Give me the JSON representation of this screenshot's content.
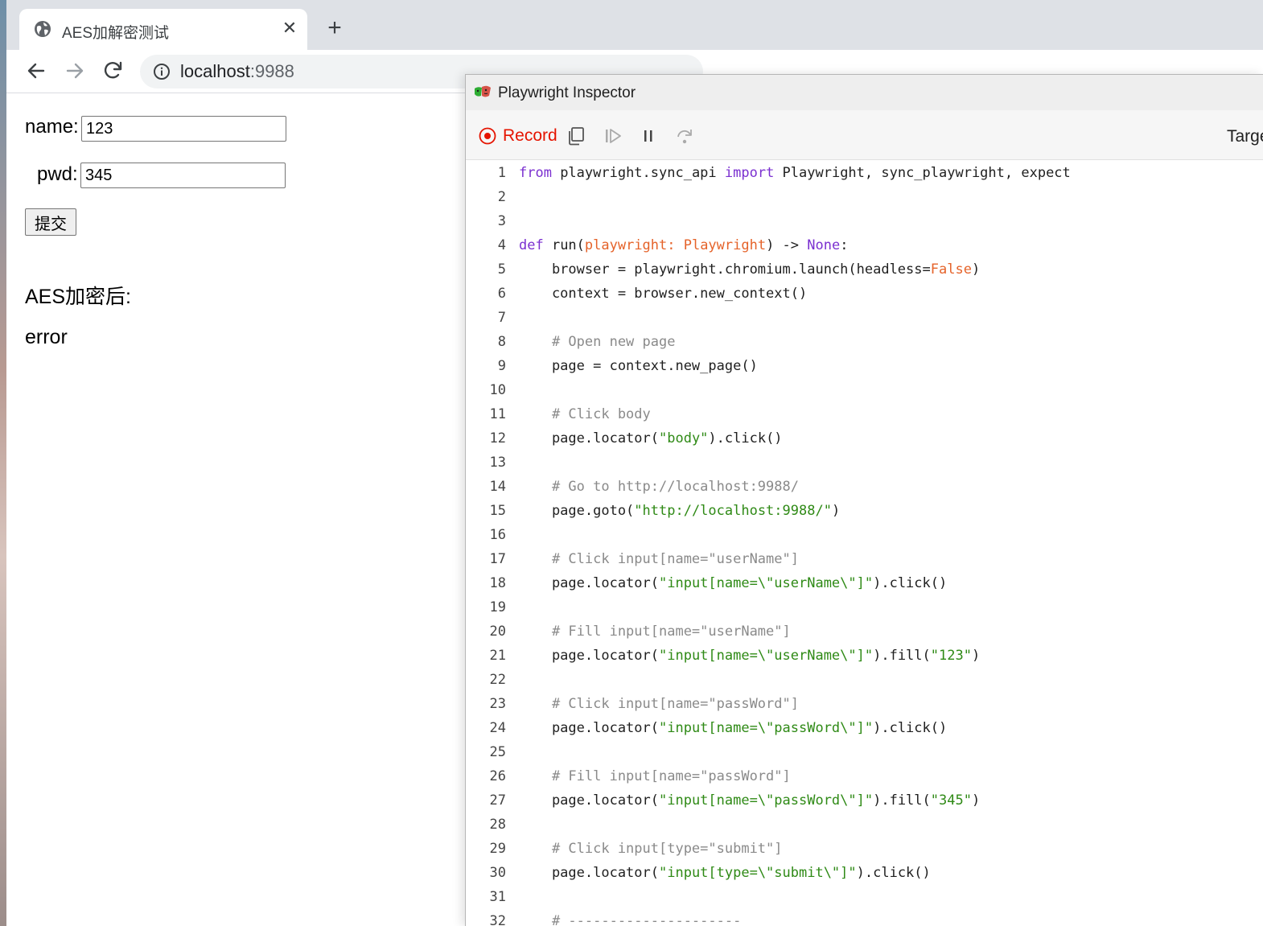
{
  "browser": {
    "tab": {
      "title": "AES加解密测试",
      "icon": "globe-icon",
      "close_icon": "close-icon"
    },
    "new_tab_icon": "plus-icon",
    "nav": {
      "back_icon": "arrow-left-icon",
      "forward_icon": "arrow-right-icon",
      "reload_icon": "reload-icon"
    },
    "address": {
      "host": "localhost",
      "port": ":9988",
      "info_icon": "info-icon"
    }
  },
  "page": {
    "name_label": "name:",
    "name_value": "123",
    "pwd_label": "pwd:",
    "pwd_value": "345",
    "submit_label": "提交",
    "result_label": "AES加密后:",
    "result_value": "error"
  },
  "inspector": {
    "title": "Playwright Inspector",
    "record_label": "Record",
    "target_label": "Target:",
    "icons": [
      "record-icon",
      "copy-icon",
      "resume-icon",
      "pause-icon",
      "step-over-icon"
    ],
    "code_lines": [
      [
        [
          "kw",
          "from"
        ],
        [
          "t",
          " playwright.sync_api "
        ],
        [
          "kw",
          "import"
        ],
        [
          "t",
          " Playwright, sync_playwright, expect"
        ]
      ],
      [],
      [],
      [
        [
          "kw",
          "def"
        ],
        [
          "t",
          " run("
        ],
        [
          "param",
          "playwright: Playwright"
        ],
        [
          "t",
          ") -> "
        ],
        [
          "none",
          "None"
        ],
        [
          "t",
          ":"
        ]
      ],
      [
        [
          "t",
          "    browser = playwright.chromium.launch(headless="
        ],
        [
          "const",
          "False"
        ],
        [
          "t",
          ")"
        ]
      ],
      [
        [
          "t",
          "    context = browser.new_context()"
        ]
      ],
      [],
      [
        [
          "cmt",
          "    # Open new page"
        ]
      ],
      [
        [
          "t",
          "    page = context.new_page()"
        ]
      ],
      [],
      [
        [
          "cmt",
          "    # Click body"
        ]
      ],
      [
        [
          "t",
          "    page.locator("
        ],
        [
          "str",
          "\"body\""
        ],
        [
          "t",
          ").click()"
        ]
      ],
      [],
      [
        [
          "cmt",
          "    # Go to http://localhost:9988/"
        ]
      ],
      [
        [
          "t",
          "    page.goto("
        ],
        [
          "str",
          "\"http://localhost:9988/\""
        ],
        [
          "t",
          ")"
        ]
      ],
      [],
      [
        [
          "cmt",
          "    # Click input[name=\"userName\"]"
        ]
      ],
      [
        [
          "t",
          "    page.locator("
        ],
        [
          "str",
          "\"input[name=\\\"userName\\\"]\""
        ],
        [
          "t",
          ").click()"
        ]
      ],
      [],
      [
        [
          "cmt",
          "    # Fill input[name=\"userName\"]"
        ]
      ],
      [
        [
          "t",
          "    page.locator("
        ],
        [
          "str",
          "\"input[name=\\\"userName\\\"]\""
        ],
        [
          "t",
          ").fill("
        ],
        [
          "str",
          "\"123\""
        ],
        [
          "t",
          ")"
        ]
      ],
      [],
      [
        [
          "cmt",
          "    # Click input[name=\"passWord\"]"
        ]
      ],
      [
        [
          "t",
          "    page.locator("
        ],
        [
          "str",
          "\"input[name=\\\"passWord\\\"]\""
        ],
        [
          "t",
          ").click()"
        ]
      ],
      [],
      [
        [
          "cmt",
          "    # Fill input[name=\"passWord\"]"
        ]
      ],
      [
        [
          "t",
          "    page.locator("
        ],
        [
          "str",
          "\"input[name=\\\"passWord\\\"]\""
        ],
        [
          "t",
          ").fill("
        ],
        [
          "str",
          "\"345\""
        ],
        [
          "t",
          ")"
        ]
      ],
      [],
      [
        [
          "cmt",
          "    # Click input[type=\"submit\"]"
        ]
      ],
      [
        [
          "t",
          "    page.locator("
        ],
        [
          "str",
          "\"input[type=\\\"submit\\\"]\""
        ],
        [
          "t",
          ").click()"
        ]
      ],
      [],
      [
        [
          "cmt",
          "    # ---------------------"
        ]
      ]
    ]
  }
}
